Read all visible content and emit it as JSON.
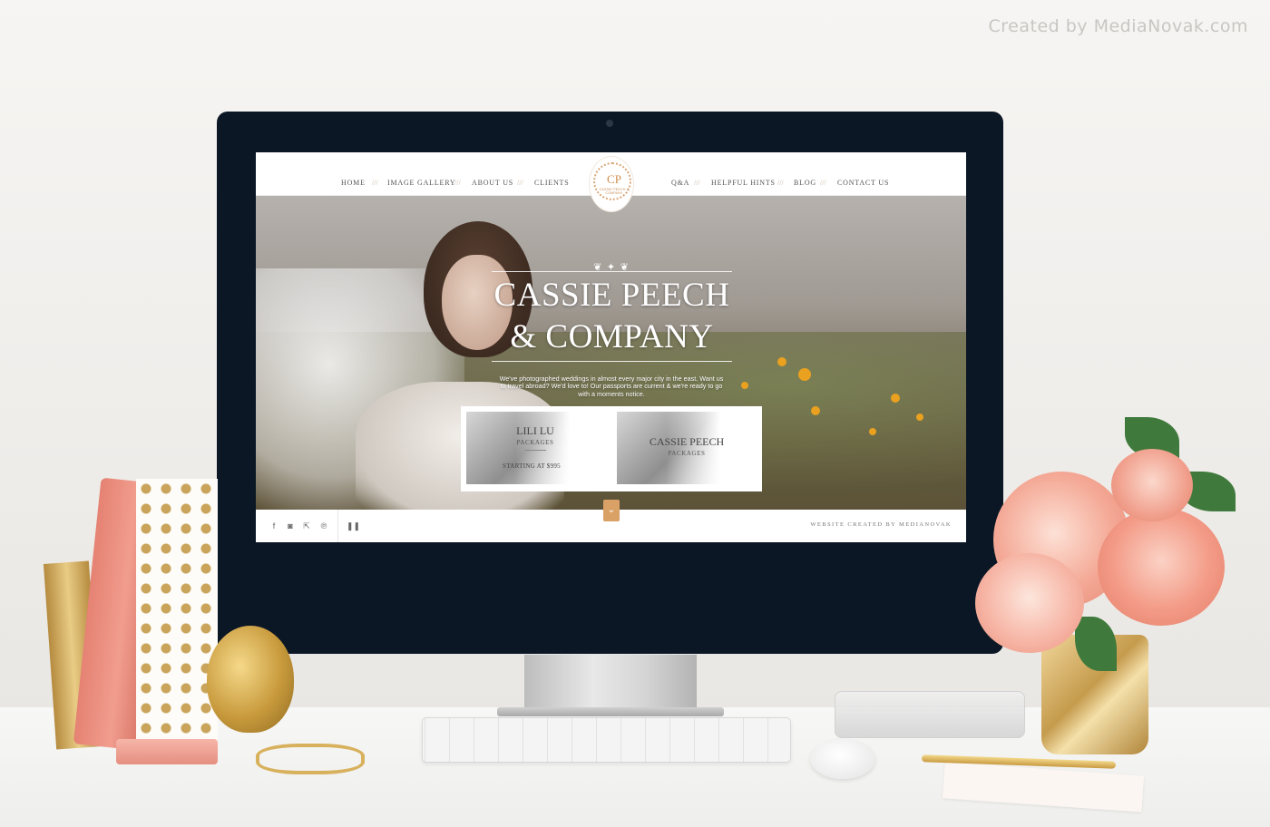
{
  "watermark": "Created by MediaNovak.com",
  "site": {
    "nav_left": [
      "HOME",
      "IMAGE GALLERY",
      "ABOUT US",
      "CLIENTS"
    ],
    "nav_right": [
      "Q&A",
      "HELPFUL HINTS",
      "BLOG",
      "CONTACT US"
    ],
    "separator": "///",
    "logo": {
      "monogram": "CP",
      "text": "CASSIE PEECH & COMPANY"
    },
    "hero": {
      "title_line1": "CASSIE PEECH",
      "title_line2": "& COMPANY",
      "text": "We've photographed weddings in almost every major city in the east. Want us to travel abroad? We'd love to! Our passports are current & we're ready to go with a moments notice."
    },
    "cards": [
      {
        "title": "LILI LU",
        "subtitle": "PACKAGES",
        "price": "STARTING AT $995"
      },
      {
        "title": "CASSIE PEECH",
        "subtitle": "PACKAGES"
      }
    ],
    "footer": {
      "icons": [
        "facebook-icon",
        "instagram-icon",
        "external-link-icon",
        "pinterest-icon",
        "pause-icon"
      ],
      "credit": "WEBSITE CREATED BY MEDIANOVAK"
    }
  }
}
